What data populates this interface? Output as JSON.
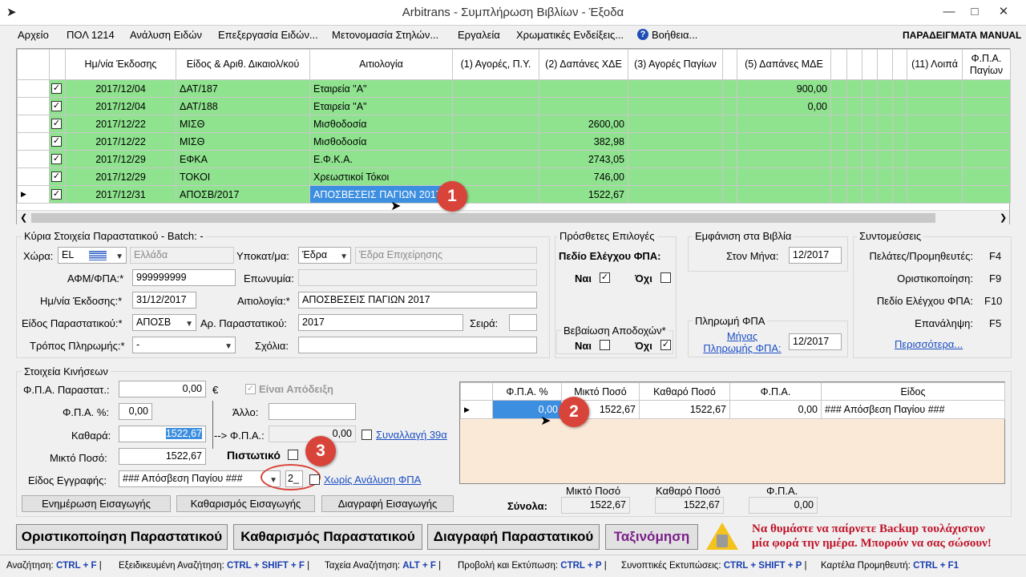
{
  "window": {
    "title": "Arbitrans - Συμπλήρωση Βιβλίων - Έξοδα"
  },
  "menu": [
    "Αρχείο",
    "ΠΟΛ 1214",
    "Ανάλυση Ειδών",
    "Επεξεργασία Ειδών...",
    "Μετονομασία Στηλών...",
    "Εργαλεία",
    "Χρωματικές Ενδείξεις...",
    "Βοήθεια..."
  ],
  "manual_label": "ΠΑΡΑΔΕΙΓΜΑΤΑ MANUAL",
  "grid": {
    "headers": [
      "Ημ/νία Έκδοσης",
      "Είδος & Αριθ. Δικαιολ/κού",
      "Αιτιολογία",
      "(1) Αγορές, Π.Υ.",
      "(2) Δαπάνες ΧΔΕ",
      "(3) Αγορές Παγίων",
      "(5) Δαπάνες ΜΔΕ",
      "(11) Λοιπά",
      "Φ.Π.Α. Παγίων"
    ],
    "rows": [
      {
        "date": "2017/12/04",
        "doc": "ΔΑΤ/187",
        "reason": "Εταιρεία \"Α\"",
        "c1": "",
        "c2": "",
        "c3": "",
        "c5": "900,00",
        "c11": ""
      },
      {
        "date": "2017/12/04",
        "doc": "ΔΑΤ/188",
        "reason": "Εταιρεία \"Α\"",
        "c1": "",
        "c2": "",
        "c3": "",
        "c5": "0,00",
        "c11": ""
      },
      {
        "date": "2017/12/22",
        "doc": "ΜΙΣΘ",
        "reason": "Μισθοδοσία",
        "c1": "",
        "c2": "2600,00",
        "c3": "",
        "c5": "",
        "c11": ""
      },
      {
        "date": "2017/12/22",
        "doc": "ΜΙΣΘ",
        "reason": "Μισθοδοσία",
        "c1": "",
        "c2": "382,98",
        "c3": "",
        "c5": "",
        "c11": ""
      },
      {
        "date": "2017/12/29",
        "doc": "ΕΦΚΑ",
        "reason": "Ε.Φ.Κ.Α.",
        "c1": "",
        "c2": "2743,05",
        "c3": "",
        "c5": "",
        "c11": ""
      },
      {
        "date": "2017/12/29",
        "doc": "ΤΟΚΟΙ",
        "reason": "Χρεωστικοί Τόκοι",
        "c1": "",
        "c2": "746,00",
        "c3": "",
        "c5": "",
        "c11": ""
      },
      {
        "date": "2017/12/31",
        "doc": "ΑΠΟΣΒ/2017",
        "reason": "ΑΠΟΣΒΕΣΕΙΣ ΠΑΓΙΩΝ 2017",
        "c1": "",
        "c2": "1522,67",
        "c3": "",
        "c5": "",
        "c11": ""
      }
    ]
  },
  "main_info": {
    "title": "Κύρια Στοιχεία Παραστατικού - Batch: -",
    "country_label": "Χώρα:",
    "country_code": "EL",
    "country_name": "Ελλάδα",
    "branch_label": "Υποκατ/μα:",
    "branch_value": "Έδρα",
    "branch_desc": "Έδρα Επιχείρησης",
    "afm_label": "ΑΦΜ/ΦΠΑ:*",
    "afm_value": "999999999",
    "name_label": "Επωνυμία:",
    "name_value": "",
    "date_label": "Ημ/νία Έκδοσης:*",
    "date_value": "31/12/2017",
    "reason_label": "Αιτιολογία:*",
    "reason_value": "ΑΠΟΣΒΕΣΕΙΣ ΠΑΓΙΩΝ 2017",
    "doctype_label": "Είδος Παραστατικού:*",
    "doctype_value": "ΑΠΟΣΒ",
    "docnum_label": "Αρ. Παραστατικού:",
    "docnum_value": "2017",
    "series_label": "Σειρά:",
    "series_value": "",
    "payment_label": "Τρόπος Πληρωμής:*",
    "payment_value": "-",
    "comments_label": "Σχόλια:",
    "comments_value": ""
  },
  "extra": {
    "title": "Πρόσθετες Επιλογές",
    "vat_check_label": "Πεδίο Ελέγχου ΦΠΑ:",
    "yes": "Ναι",
    "no": "Όχι",
    "receipt_title": "Βεβαίωση Αποδοχών*"
  },
  "books": {
    "title": "Εμφάνιση στα Βιβλία",
    "month_label": "Στον Μήνα:",
    "month_value": "12/2017",
    "vatpay_title": "Πληρωμή ΦΠΑ",
    "vatpay_link": "Μήνας Πληρωμής ΦΠΑ:",
    "vatpay_value": "12/2017"
  },
  "shortcuts": {
    "title": "Συντομεύσεις",
    "items": [
      {
        "label": "Πελάτες/Προμηθευτές:",
        "key": "F4"
      },
      {
        "label": "Οριστικοποίηση:",
        "key": "F9"
      },
      {
        "label": "Πεδίο Ελέγχου ΦΠΑ:",
        "key": "F10"
      },
      {
        "label": "Επανάληψη:",
        "key": "F5"
      }
    ],
    "more": "Περισσότερα..."
  },
  "movements": {
    "title": "Στοιχεία Κινήσεων",
    "vat_doc_label": "Φ.Π.Α. Παραστατ.:",
    "vat_doc_value": "0,00",
    "currency": "€",
    "is_receipt": "Είναι Απόδειξη",
    "vat_pct_label": "Φ.Π.Α. %:",
    "vat_pct_value": "0,00",
    "other_label": "Άλλο:",
    "other_value": "",
    "net_label": "Καθαρά:",
    "net_value": "1522,67",
    "arrow_vat_label": "--> Φ.Π.Α.:",
    "arrow_vat_value": "0,00",
    "trans39_link": "Συναλλαγή 39α",
    "gross_label": "Μικτό Ποσό:",
    "gross_value": "1522,67",
    "credit_label": "Πιστωτικό",
    "entry_type_label": "Είδος Εγγραφής:",
    "entry_type_value": "### Απόσβεση Παγίου ###",
    "code_value": "2_",
    "no_vat_link": "Χωρίς Ανάλυση ΦΠΑ",
    "btn_update": "Ενημέρωση Εισαγωγής",
    "btn_clear": "Καθαρισμός Εισαγωγής",
    "btn_delete": "Διαγραφή Εισαγωγής"
  },
  "subgrid": {
    "headers": [
      "Φ.Π.Α. %",
      "Μικτό Ποσό",
      "Καθαρό Ποσό",
      "Φ.Π.Α.",
      "Είδος"
    ],
    "row": {
      "vat_pct": "0,00",
      "gross": "1522,67",
      "net": "1522,67",
      "vat": "0,00",
      "kind": "### Απόσβεση Παγίου ###"
    }
  },
  "totals": {
    "label": "Σύνολα:",
    "headers": [
      "Μικτό Ποσό",
      "Καθαρό Ποσό",
      "Φ.Π.Α."
    ],
    "gross": "1522,67",
    "net": "1522,67",
    "vat": "0,00"
  },
  "actions": {
    "finalize": "Οριστικοποίηση Παραστατικού",
    "clear": "Καθαρισμός Παραστατικού",
    "delete": "Διαγραφή Παραστατικού",
    "sort": "Ταξινόμηση"
  },
  "backup_note": {
    "line1": "Να θυμάστε να παίρνετε Backup τουλάχιστον",
    "line2": "μία φορά την ημέρα. Μπορούν να σας σώσουν!"
  },
  "badges": [
    "1",
    "2",
    "3"
  ],
  "statusbar": [
    {
      "label": "Αναζήτηση:",
      "key": "CTRL + F"
    },
    {
      "label": "Εξειδικευμένη Αναζήτηση:",
      "key": "CTRL + SHIFT + F"
    },
    {
      "label": "Ταχεία Αναζήτηση:",
      "key": "ALT + F"
    },
    {
      "label": "Προβολή και Εκτύπωση:",
      "key": "CTRL + P"
    },
    {
      "label": "Συνοπτικές Εκτυπώσεις:",
      "key": "CTRL + SHIFT + P"
    },
    {
      "label": "Καρτέλα Προμηθευτή:",
      "key": "CTRL + F1"
    }
  ],
  "colors": {
    "row_green": "#8fe38f",
    "selection": "#3c8ee0",
    "badge": "#d9443a",
    "note_red": "#c0142a",
    "sort_purple": "#7a1f8a"
  }
}
